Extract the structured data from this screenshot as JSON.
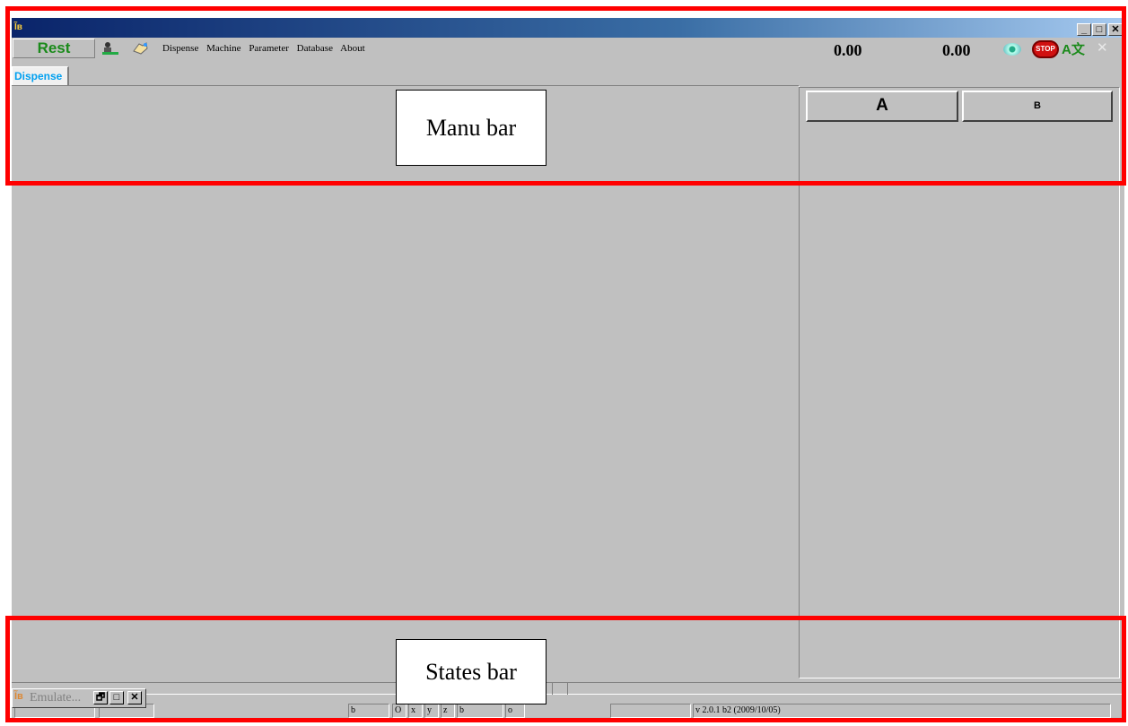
{
  "window": {
    "app_icon": "Ĩв"
  },
  "titlebar_buttons": {
    "minimize": "_",
    "maximize": "□",
    "close": "✕"
  },
  "toolbar": {
    "rest_label": "Rest",
    "tool_icons": [
      "operator-icon",
      "hand-icon"
    ]
  },
  "menu": {
    "items": [
      "Dispense",
      "Machine",
      "Parameter",
      "Database",
      "About"
    ]
  },
  "readouts": {
    "value_1": "0.00",
    "value_2": "0.00"
  },
  "right_icons": {
    "stop_label": "STOP",
    "translate_label": "A文",
    "close_label": "✕"
  },
  "tabs": [
    {
      "label": "Dispense",
      "active": true
    }
  ],
  "side_buttons": {
    "a_label": "A",
    "b_label": "B"
  },
  "annotations": {
    "menu_bar": "Manu bar",
    "states_bar": "States bar",
    "color": "#ff0000"
  },
  "minimized_window": {
    "title": "Emulate...",
    "restore": "🗗",
    "maximize": "□",
    "close": "✕"
  },
  "statusbar": {
    "cells": [
      "",
      "",
      "b",
      "O",
      "x",
      "y",
      "z",
      "b",
      "o",
      "",
      "v 2.0.1 b2 (2009/10/05)",
      ""
    ]
  }
}
